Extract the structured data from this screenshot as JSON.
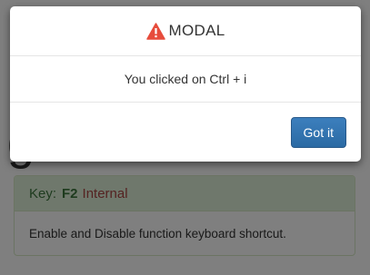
{
  "modal": {
    "title": "MODAL",
    "message": "You clicked on Ctrl + i",
    "button_label": "Got it",
    "icon": "warning-icon",
    "icon_color": "#e74c3c"
  },
  "background": {
    "heading": "g",
    "panel": {
      "key_label": "Key:",
      "key_code": "F2",
      "key_category": "Internal",
      "description": "Enable and Disable function keyboard shortcut."
    }
  },
  "colors": {
    "primary_button": "#337ab7",
    "panel_heading_bg": "#dff0d8",
    "panel_heading_text": "#3c763d",
    "category_text": "#a94442"
  }
}
